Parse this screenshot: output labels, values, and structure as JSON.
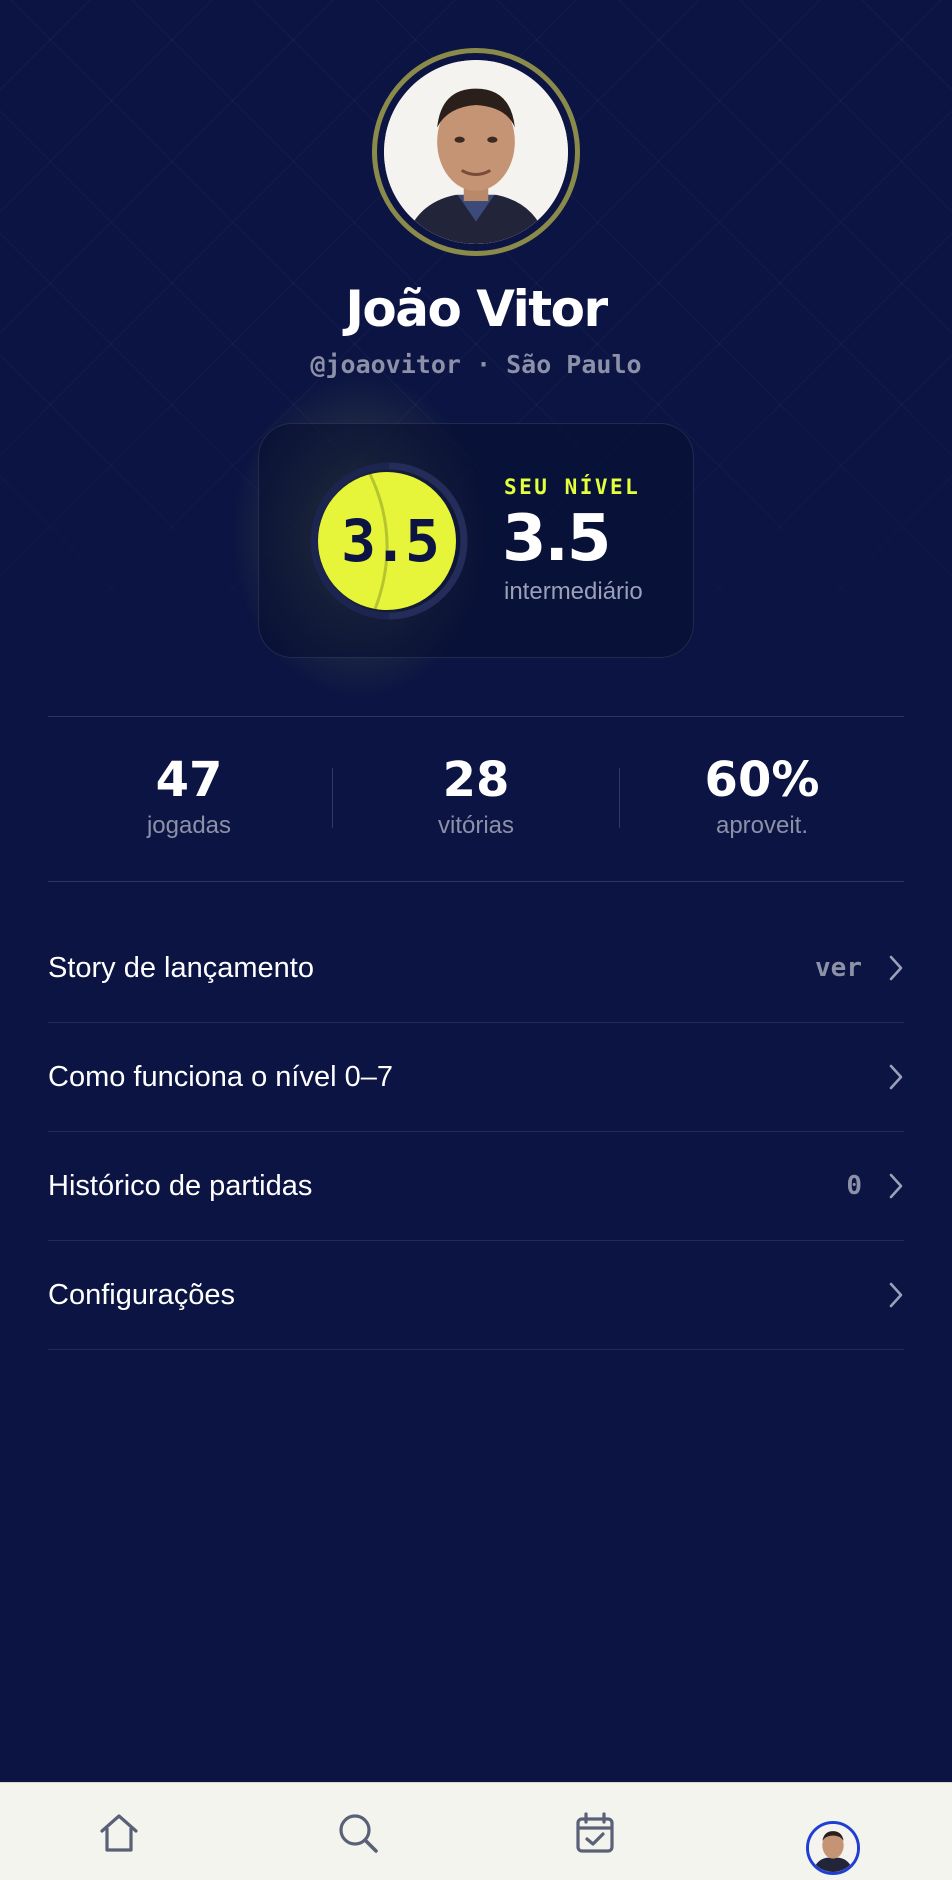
{
  "profile": {
    "name": "João Vitor",
    "handle_line": "@joaovitor · São Paulo",
    "avatar_alt": "profile-photo"
  },
  "level": {
    "ball_value": "3.5",
    "label": "SEU NÍVEL",
    "value": "3.5",
    "description": "intermediário",
    "ball_color": "#e4ff3c",
    "progress_fraction": 0.5
  },
  "stats": [
    {
      "value": "47",
      "label": "jogadas"
    },
    {
      "value": "28",
      "label": "vitórias"
    },
    {
      "value": "60%",
      "label": "aproveit."
    }
  ],
  "menu": [
    {
      "label": "Story de lançamento",
      "extra": "ver"
    },
    {
      "label": "Como funciona o nível 0–7",
      "extra": ""
    },
    {
      "label": "Histórico de partidas",
      "extra": "0"
    },
    {
      "label": "Configurações",
      "extra": ""
    }
  ],
  "tabbar": {
    "items": [
      "home-icon",
      "search-icon",
      "calendar-check-icon",
      "profile-avatar"
    ],
    "active": "profile-avatar"
  },
  "colors": {
    "background": "#0b1442",
    "accent": "#e4ff3c",
    "muted_text": "#8c91a8",
    "tabbar_bg": "#f3f4ee"
  }
}
